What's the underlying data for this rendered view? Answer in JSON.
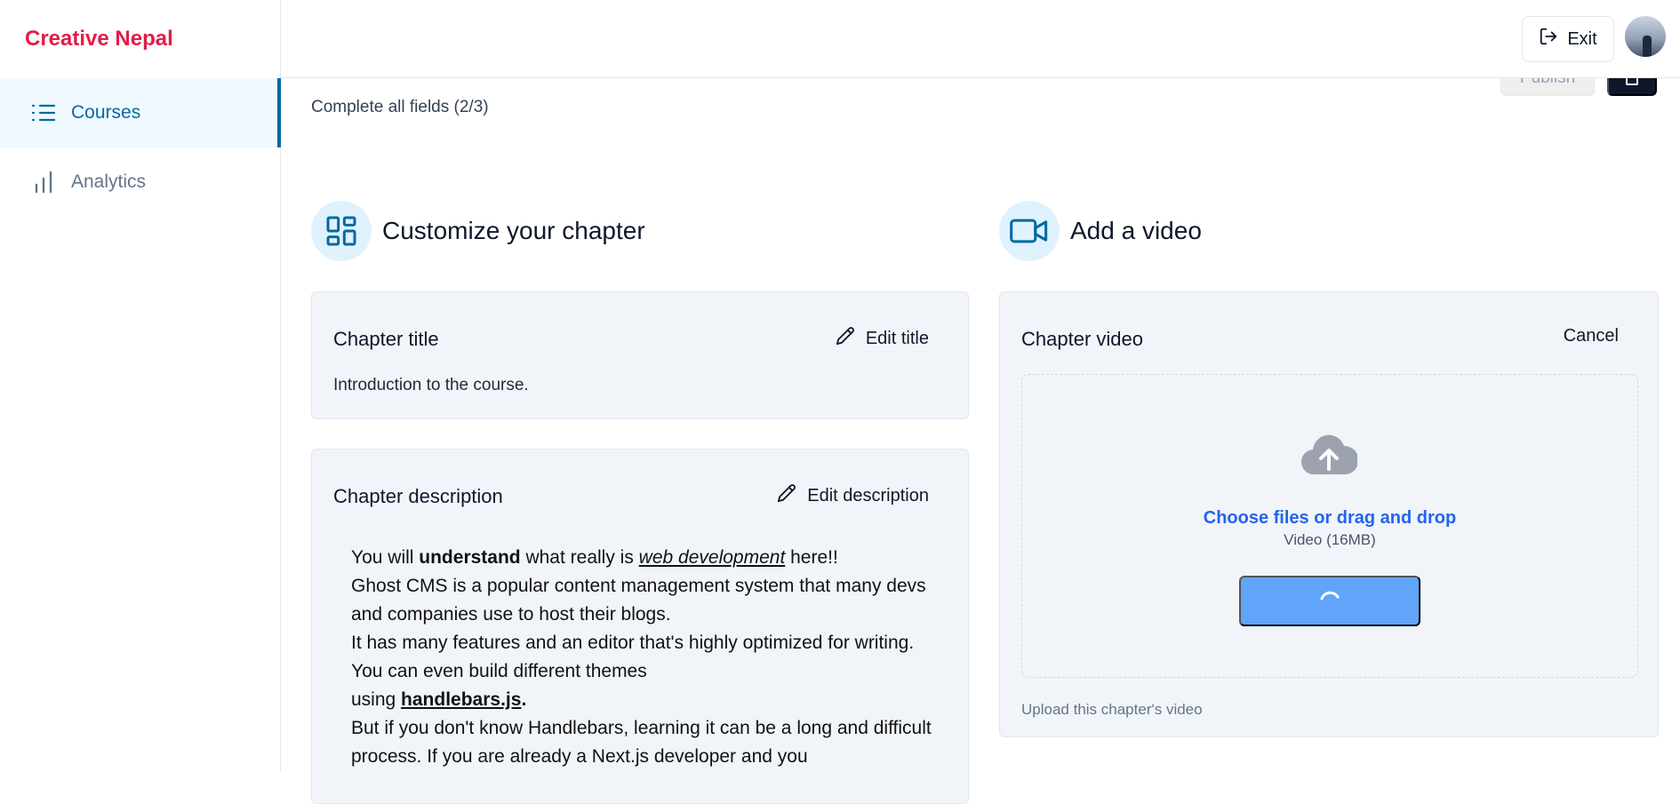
{
  "brand": {
    "name": "Creative Nepal",
    "color": "#e11d48"
  },
  "sidebar": {
    "items": [
      {
        "label": "Courses",
        "icon": "list-icon",
        "active": true
      },
      {
        "label": "Analytics",
        "icon": "bar-chart-icon",
        "active": false
      }
    ]
  },
  "header": {
    "exit_label": "Exit",
    "avatar": "user-avatar"
  },
  "page": {
    "subtitle": "Complete all fields (2/3)",
    "publish_label": "Publish",
    "delete_icon": "trash-icon"
  },
  "customize": {
    "heading": "Customize your chapter",
    "icon": "layout-dashboard-icon",
    "title_card": {
      "label": "Chapter title",
      "action": "Edit title",
      "value": "Introduction to the course."
    },
    "description_card": {
      "label": "Chapter description",
      "action": "Edit description",
      "lines": {
        "l1_a": "You will ",
        "l1_b": "understand",
        "l1_c": " what really is ",
        "l1_d": "web development",
        "l1_e": " here!!",
        "l2": "Ghost CMS is a popular content management system that many devs and companies use to host their blogs.",
        "l3": "It has many features and an editor that's highly optimized for writing. You can even build different themes",
        "l4_a": "using ",
        "l4_b": "handlebars.js",
        "l4_c": ".",
        "l5": "But if you don't know Handlebars, learning it can be a long and difficult process. If you are already a Next.js developer and you"
      }
    }
  },
  "video": {
    "heading": "Add a video",
    "icon": "video-icon",
    "card": {
      "label": "Chapter video",
      "action": "Cancel",
      "drop_link": "Choose files or drag and drop",
      "drop_hint": "Video (16MB)",
      "footer": "Upload this chapter's video"
    }
  },
  "colors": {
    "accent": "#0369a1",
    "upload_button": "#60a5fa",
    "link": "#2563eb"
  }
}
